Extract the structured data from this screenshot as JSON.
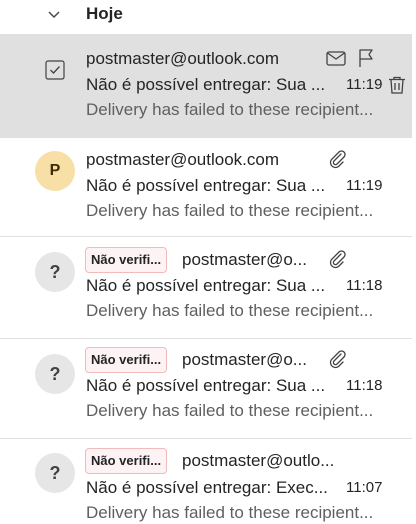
{
  "group": {
    "title": "Hoje",
    "collapse_icon": "chevron-down-icon"
  },
  "messages": [
    {
      "sender": "postmaster@outlook.com",
      "subject": "Não é possível entregar: Sua ...",
      "time": "11:19",
      "preview": "Delivery has failed to these recipient...",
      "selected": true,
      "hover_actions": [
        "mark-read-icon",
        "flag-icon",
        "delete-icon"
      ]
    },
    {
      "sender": "postmaster@outlook.com",
      "subject": "Não é possível entregar: Sua ...",
      "time": "11:19",
      "preview": "Delivery has failed to these recipient...",
      "avatar_initial": "P",
      "has_attachment": true
    },
    {
      "badge": "Não verifi...",
      "sender": "postmaster@o...",
      "subject": "Não é possível entregar: Sua ...",
      "time": "11:18",
      "preview": "Delivery has failed to these recipient...",
      "avatar_initial": "?",
      "has_attachment": true
    },
    {
      "badge": "Não verifi...",
      "sender": "postmaster@o...",
      "subject": "Não é possível entregar: Sua ...",
      "time": "11:18",
      "preview": "Delivery has failed to these recipient...",
      "avatar_initial": "?",
      "has_attachment": true
    },
    {
      "badge": "Não verifi...",
      "sender": "postmaster@outlo...",
      "subject": "Não é possível entregar: Exec...",
      "time": "11:07",
      "preview": "Delivery has failed to these recipient...",
      "avatar_initial": "?",
      "has_attachment": false
    }
  ]
}
